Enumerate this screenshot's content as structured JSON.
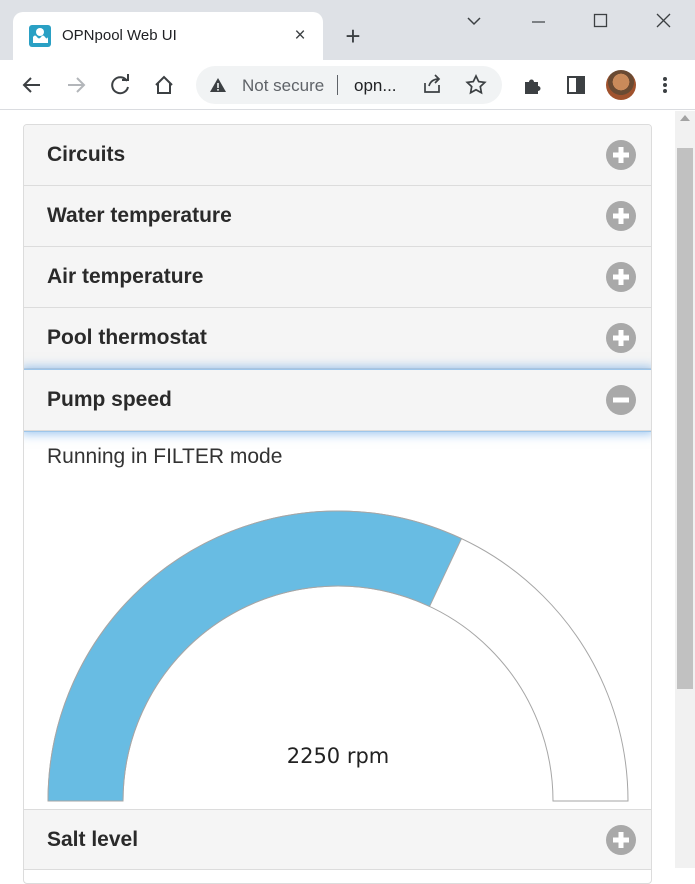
{
  "browser": {
    "tab_title": "OPNpool Web UI",
    "tab_close_glyph": "×",
    "new_tab_glyph": "+",
    "security_label": "Not secure",
    "url": "opn...",
    "icons": [
      "favicon",
      "close-icon",
      "new-tab-icon",
      "chevron-down-icon",
      "minimize-icon",
      "maximize-icon",
      "window-close-icon",
      "back-arrow-icon",
      "forward-arrow-icon",
      "reload-icon",
      "home-icon",
      "warning-icon",
      "share-icon",
      "star-icon",
      "extensions-icon",
      "side-panel-icon",
      "avatar",
      "more-vert-icon"
    ]
  },
  "accordion": {
    "sections": [
      {
        "label": "Circuits",
        "expanded": false
      },
      {
        "label": "Water temperature",
        "expanded": false
      },
      {
        "label": "Air temperature",
        "expanded": false
      },
      {
        "label": "Pool thermostat",
        "expanded": false
      },
      {
        "label": "Pump speed",
        "expanded": true
      },
      {
        "label": "Salt level",
        "expanded": false
      }
    ]
  },
  "pump": {
    "status_text": "Running in FILTER mode",
    "speed_label": "2250 rpm",
    "gauge_fraction": 0.64,
    "fill_color": "#68bce3"
  }
}
